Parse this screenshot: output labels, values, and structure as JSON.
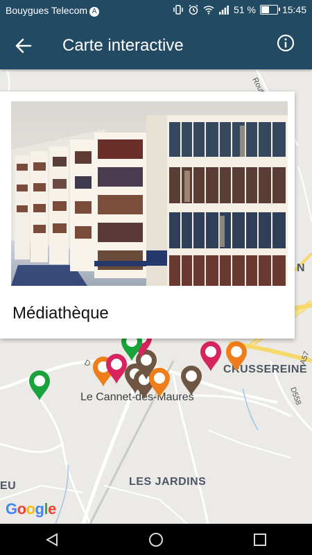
{
  "status_bar": {
    "carrier": "Bouygues Telecom",
    "battery_percent": "51 %",
    "time": "15:45",
    "battery_level": 0.51,
    "icons": [
      "vibrate-icon",
      "alarm-icon",
      "wifi-icon",
      "signal-icon",
      "battery-icon"
    ]
  },
  "app_bar": {
    "title": "Carte interactive",
    "back_icon": "arrow-left-icon",
    "info_icon": "info-icon",
    "background": "#234a63"
  },
  "card": {
    "title": "Médiathèque",
    "image": "library-bookshelves-photo"
  },
  "map": {
    "town": "Le Cannet-des-Maures",
    "area_labels": [
      "LES JARDINS",
      "CRUSSEREINE",
      "N",
      "EU"
    ],
    "road_labels": [
      "D558",
      "A57",
      "Route d",
      "D"
    ],
    "attribution": "Google",
    "pins": [
      {
        "color": "#1aa33b"
      },
      {
        "color": "#ef7d1a"
      },
      {
        "color": "#d6245f"
      },
      {
        "color": "#6e5642"
      },
      {
        "color": "#6e5642"
      },
      {
        "color": "#6e5642"
      },
      {
        "color": "#ef7d1a"
      },
      {
        "color": "#6e5642"
      },
      {
        "color": "#d6245f"
      },
      {
        "color": "#ef7d1a"
      },
      {
        "color": "#d6245f"
      },
      {
        "color": "#1aa33b"
      }
    ]
  },
  "nav_bar": {
    "back_icon": "triangle-back-icon",
    "home_icon": "circle-home-icon",
    "recents_icon": "square-recents-icon"
  }
}
